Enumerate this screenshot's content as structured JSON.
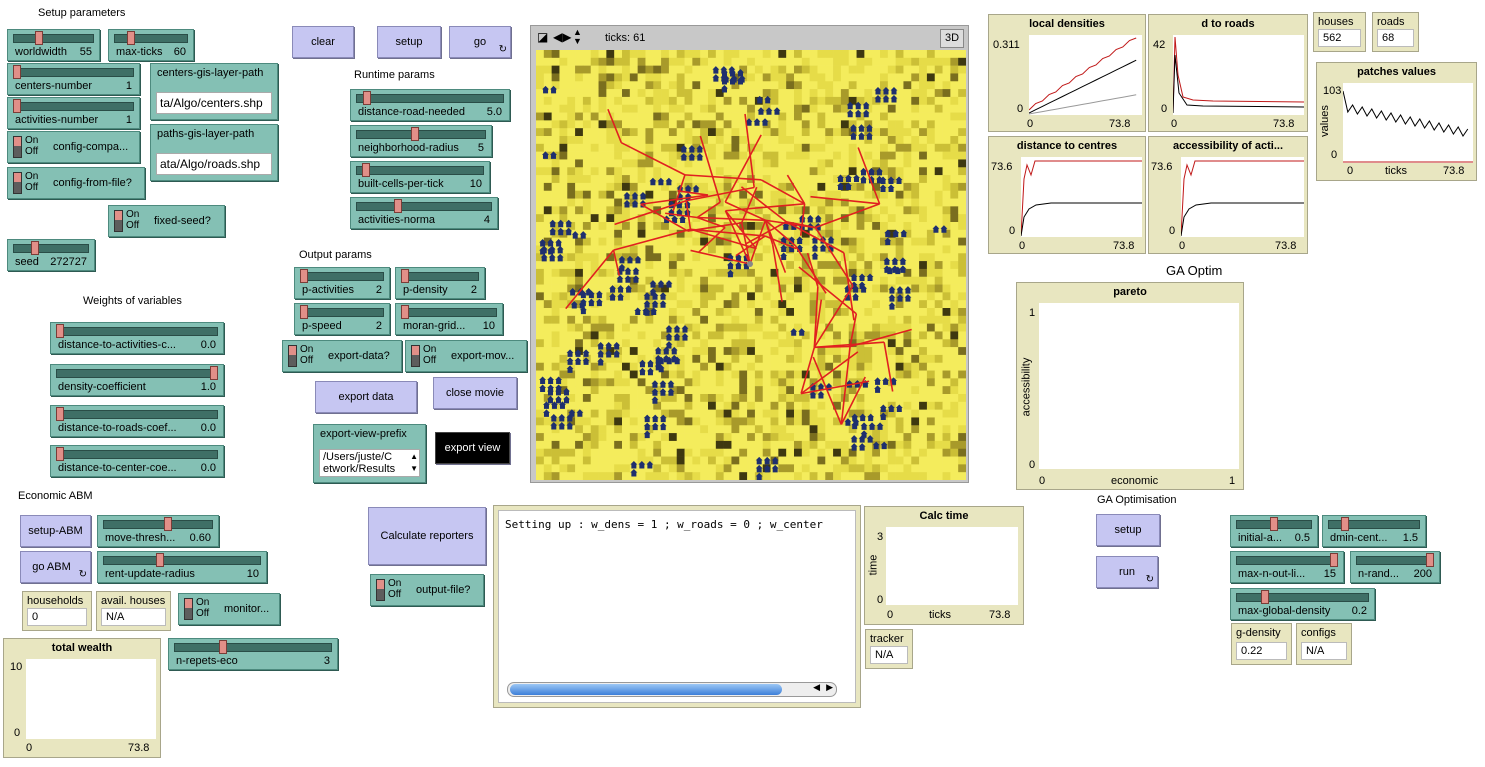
{
  "headings": {
    "setup": "Setup parameters",
    "runtime": "Runtime params",
    "output": "Output params",
    "weights": "Weights of variables",
    "economic": "Economic ABM",
    "ga_optim": "GA Optim",
    "ga_optimisation": "GA Optimisation"
  },
  "switch_state": {
    "on": "On",
    "off": "Off"
  },
  "buttons": {
    "clear": "clear",
    "setup": "setup",
    "go": "go",
    "export_data": "export data",
    "close_movie": "close movie",
    "export_view": "export view",
    "calculate_reporters": "Calculate reporters",
    "setup_abm": "setup-ABM",
    "go_abm": "go ABM",
    "ga_setup": "setup",
    "ga_run": "run",
    "forever_icon": "forever-arrows-icon"
  },
  "sliders": {
    "worldwidth": {
      "name": "worldwidth",
      "value": "55",
      "fraction": 0.3
    },
    "max_ticks": {
      "name": "max-ticks",
      "value": "60",
      "fraction": 0.2
    },
    "centers_number": {
      "name": "centers-number",
      "value": "1",
      "fraction": 0.0
    },
    "activities_number": {
      "name": "activities-number",
      "value": "1",
      "fraction": 0.0
    },
    "seed": {
      "name": "seed",
      "value": "272727",
      "fraction": 0.27
    },
    "distance_road_needed": {
      "name": "distance-road-needed",
      "value": "5.0",
      "fraction": 0.05
    },
    "neighborhood_radius": {
      "name": "neighborhood-radius",
      "value": "5",
      "fraction": 0.45
    },
    "built_cells_per_tick": {
      "name": "built-cells-per-tick",
      "value": "10",
      "fraction": 0.05
    },
    "activities_norma": {
      "name": "activities-norma",
      "value": "4",
      "fraction": 0.3
    },
    "p_activities": {
      "name": "p-activities",
      "value": "2",
      "fraction": 0.0
    },
    "p_density": {
      "name": "p-density",
      "value": "2",
      "fraction": 0.0
    },
    "p_speed": {
      "name": "p-speed",
      "value": "2",
      "fraction": 0.0
    },
    "moran_grid": {
      "name": "moran-grid...",
      "value": "10",
      "fraction": 0.0
    },
    "distance_to_activities": {
      "name": "distance-to-activities-c...",
      "value": "0.0",
      "fraction": 0.0
    },
    "density_coefficient": {
      "name": "density-coefficient",
      "value": "1.0",
      "fraction": 1.0
    },
    "distance_to_roads": {
      "name": "distance-to-roads-coef...",
      "value": "0.0",
      "fraction": 0.0
    },
    "distance_to_center": {
      "name": "distance-to-center-coe...",
      "value": "0.0",
      "fraction": 0.0
    },
    "move_threshold": {
      "name": "move-thresh...",
      "value": "0.60",
      "fraction": 0.6
    },
    "rent_update_radius": {
      "name": "rent-update-radius",
      "value": "10",
      "fraction": 0.35
    },
    "n_repets_eco": {
      "name": "n-repets-eco",
      "value": "3",
      "fraction": 0.3
    },
    "initial_a": {
      "name": "initial-a...",
      "value": "0.5",
      "fraction": 0.5
    },
    "dmin_cent": {
      "name": "dmin-cent...",
      "value": "1.5",
      "fraction": 0.15
    },
    "max_n_out_li": {
      "name": "max-n-out-li...",
      "value": "15",
      "fraction": 1.0
    },
    "n_rand": {
      "name": "n-rand...",
      "value": "200",
      "fraction": 1.0
    },
    "max_global_density": {
      "name": "max-global-density",
      "value": "0.2",
      "fraction": 0.2
    }
  },
  "switches": {
    "config_compa": {
      "name": "config-compa...",
      "state": "off"
    },
    "config_from_file": {
      "name": "config-from-file?",
      "state": "off"
    },
    "fixed_seed": {
      "name": "fixed-seed?",
      "state": "off"
    },
    "export_data": {
      "name": "export-data?",
      "state": "off"
    },
    "export_mov": {
      "name": "export-mov...",
      "state": "off"
    },
    "output_file": {
      "name": "output-file?",
      "state": "off"
    },
    "monitor": {
      "name": "monitor...",
      "state": "off"
    }
  },
  "inputs": {
    "centers_gis": {
      "label": "centers-gis-layer-path",
      "value": "ta/Algo/centers.shp"
    },
    "paths_gis": {
      "label": "paths-gis-layer-path",
      "value": "ata/Algo/roads.shp"
    },
    "export_view_prefix": {
      "label": "export-view-prefix",
      "value1": "/Users/juste/C",
      "value2": "etwork/Results"
    }
  },
  "monitors": {
    "houses": {
      "label": "houses",
      "value": "562"
    },
    "roads": {
      "label": "roads",
      "value": "68"
    },
    "households": {
      "label": "households",
      "value": "0"
    },
    "avail_houses": {
      "label": "avail. houses",
      "value": "N/A"
    },
    "tracker": {
      "label": "tracker",
      "value": "N/A"
    },
    "g_density": {
      "label": "g-density",
      "value": "0.22"
    },
    "configs": {
      "label": "configs",
      "value": "N/A"
    }
  },
  "view": {
    "ticks_label": "ticks: 61",
    "three_d": "3D"
  },
  "output": {
    "text": "Setting up : w_dens = 1 ; w_roads = 0 ; w_center"
  },
  "plots": {
    "local_densities": {
      "title": "local densities",
      "ymax": "0.311",
      "ymin": "0",
      "xmin": "0",
      "xmax": "73.8"
    },
    "d_to_roads": {
      "title": "d to roads",
      "ymax": "42",
      "ymin": "0",
      "xmin": "0",
      "xmax": "73.8"
    },
    "distance_to_centres": {
      "title": "distance to centres",
      "ymax": "73.6",
      "ymin": "0",
      "xmin": "0",
      "xmax": "73.8"
    },
    "accessibility": {
      "title": "accessibility of acti...",
      "ymax": "73.6",
      "ymin": "0",
      "xmin": "0",
      "xmax": "73.8"
    },
    "patches_values": {
      "title": "patches values",
      "ymax": "103",
      "ymin": "0",
      "xmin": "0",
      "xmax": "73.8",
      "xlabel": "ticks",
      "ylabel": "values"
    },
    "pareto": {
      "title": "pareto",
      "ymax": "1",
      "ymin": "0",
      "xmin": "0",
      "xmax": "1",
      "xlabel": "economic",
      "ylabel": "accessibility"
    },
    "calc_time": {
      "title": "Calc time",
      "ymax": "3",
      "ymin": "0",
      "xmin": "0",
      "xmax": "73.8",
      "xlabel": "ticks",
      "ylabel": "time"
    },
    "total_wealth": {
      "title": "total wealth",
      "ymax": "10",
      "ymin": "0",
      "xmin": "0",
      "xmax": "73.8"
    }
  },
  "colors": {
    "button": "#c6c6f2",
    "slider": "#84c0b4",
    "monitor": "#e8e6c0",
    "road": "#e02020",
    "house": "#1e2f6e",
    "patch_base": "#f0e860"
  }
}
